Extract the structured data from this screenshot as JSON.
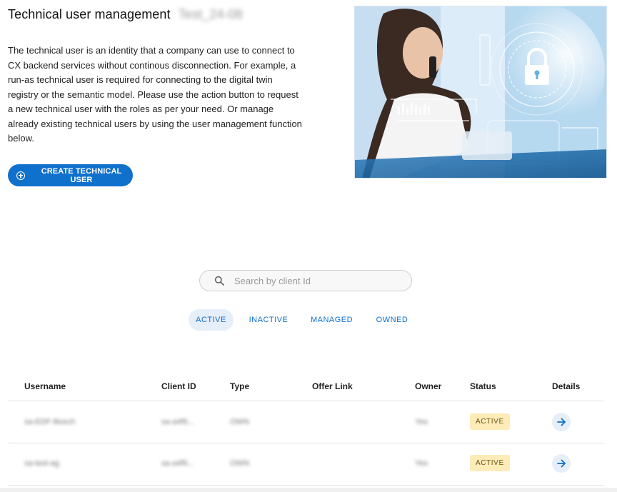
{
  "header": {
    "title": "Technical user management",
    "company_name": "Test_24-08"
  },
  "intro_text": "The technical user is an identity that a company can use to connect to CX backend services without continous disconnection. For example, a run-as technical user is required for connecting to the digital twin registry or the semantic model. Please use the action button to request a new technical user with the roles as per your need. Or manage already existing technical users by using the user management function below.",
  "create_button": {
    "label": "CREATE TECHNICAL USER",
    "icon": "add-circle-icon"
  },
  "hero_image": {
    "icon": "padlock-icon"
  },
  "search": {
    "placeholder": "Search by client Id",
    "icon": "search-icon"
  },
  "filters": [
    {
      "label": "ACTIVE",
      "selected": true
    },
    {
      "label": "INACTIVE",
      "selected": false
    },
    {
      "label": "MANAGED",
      "selected": false
    },
    {
      "label": "OWNED",
      "selected": false
    }
  ],
  "table": {
    "columns": [
      "Username",
      "Client ID",
      "Type",
      "Offer Link",
      "Owner",
      "Status",
      "Details"
    ],
    "rows": [
      {
        "username": "sa-EDF-Bosch",
        "client_id": "sa-a4f6...",
        "type": "OWN",
        "offer_link": "",
        "owner": "Yes",
        "status": "ACTIVE"
      },
      {
        "username": "sa-test-ag",
        "client_id": "sa-a4f6...",
        "type": "OWN",
        "offer_link": "",
        "owner": "Yes",
        "status": "ACTIVE"
      }
    ],
    "details_icon": "arrow-right-icon"
  },
  "colors": {
    "primary": "#0f71cb",
    "active_badge_bg": "#fdebb8",
    "filter_selected_bg": "#e6eef9"
  }
}
